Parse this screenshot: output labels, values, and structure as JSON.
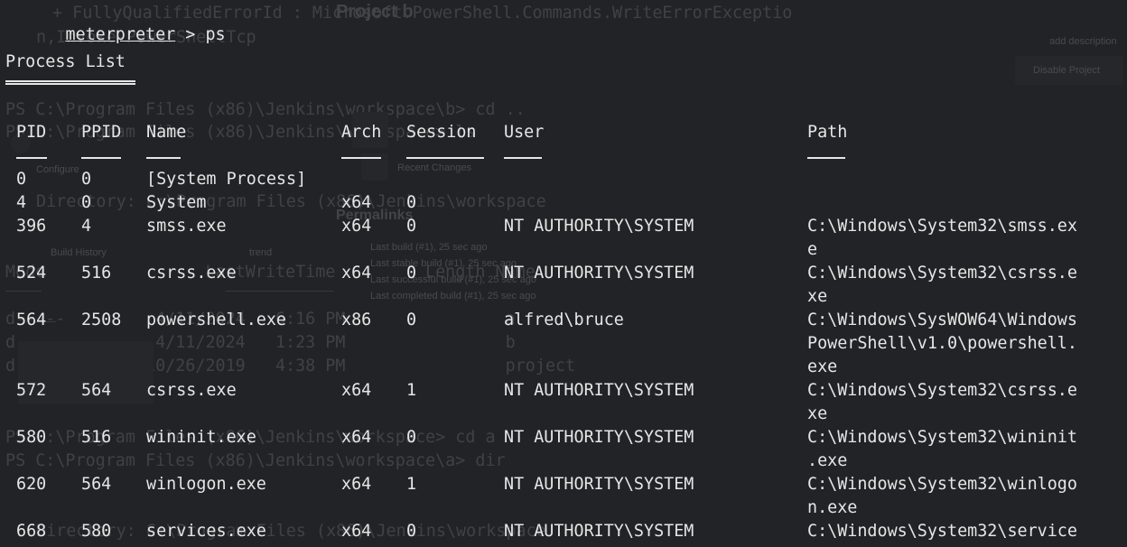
{
  "background_ghost": {
    "line1": "+ FullyQualifiedErrorId : Microsoft.PowerShell.Commands.WriteErrorExceptio",
    "line2": "n,Invoke-PowerShellTcp",
    "line3": "PS C:\\Program Files (x86)\\Jenkins\\workspace\\b> cd ..",
    "line4": "PS C:\\Program Files (x86)\\Jenkins\\workspace> ls",
    "line5": "Directory: C:\\Program Files (x86)\\Jenkins\\workspace",
    "line6": "Mode                LastWriteTime         Length Name",
    "line7": "d-----         4/11/2024   6:16 PM                a",
    "line8": "d-----         4/11/2024   1:23 PM                b",
    "line9": "d-----        10/26/2019   4:38 PM                project",
    "line10": "PS C:\\Program Files (x86)\\Jenkins\\workspace> cd a",
    "line11": "PS C:\\Program Files (x86)\\Jenkins\\workspace\\a> dir",
    "line12": "Directory: C:\\Program Files (x86)\\Jenkins\\workspace",
    "web_title": "Project b",
    "web_recent": "Recent Changes",
    "web_permalinks": "Permalinks",
    "web_build_history": "Build History",
    "web_trend": "trend",
    "web_item1": "Last build (#1), 25 sec ago",
    "web_item2": "Last stable build (#1), 25 sec ago",
    "web_item3": "Last successful build (#1), 25 sec ago",
    "web_item4": "Last completed build (#1), 25 sec ago",
    "web_add_desc": "add description",
    "web_disable": "Disable Project",
    "web_config": "Configure"
  },
  "terminal": {
    "prompt_word": "meterpreter",
    "prompt_rest": " > ps",
    "heading": "Process List",
    "columns": [
      "PID",
      "PPID",
      "Name",
      "Arch",
      "Session",
      "User",
      "Path"
    ],
    "rows": [
      {
        "pid": "0",
        "ppid": "0",
        "name": "[System Process]",
        "arch": "",
        "session": "",
        "user": "",
        "path": ""
      },
      {
        "pid": "4",
        "ppid": "0",
        "name": "System",
        "arch": "x64",
        "session": "0",
        "user": "",
        "path": ""
      },
      {
        "pid": "396",
        "ppid": "4",
        "name": "smss.exe",
        "arch": "x64",
        "session": "0",
        "user": "NT AUTHORITY\\SYSTEM",
        "path": "C:\\Windows\\System32\\smss.ex",
        "path2": "e"
      },
      {
        "pid": "524",
        "ppid": "516",
        "name": "csrss.exe",
        "arch": "x64",
        "session": "0",
        "user": "NT AUTHORITY\\SYSTEM",
        "path": "C:\\Windows\\System32\\csrss.e",
        "path2": "xe"
      },
      {
        "pid": "564",
        "ppid": "2508",
        "name": "powershell.exe",
        "arch": "x86",
        "session": "0",
        "user": "alfred\\bruce",
        "path": "C:\\Windows\\SysWOW64\\Windows",
        "path2": "PowerShell\\v1.0\\powershell.",
        "path3": "exe"
      },
      {
        "pid": "572",
        "ppid": "564",
        "name": "csrss.exe",
        "arch": "x64",
        "session": "1",
        "user": "NT AUTHORITY\\SYSTEM",
        "path": "C:\\Windows\\System32\\csrss.e",
        "path2": "xe"
      },
      {
        "pid": "580",
        "ppid": "516",
        "name": "wininit.exe",
        "arch": "x64",
        "session": "0",
        "user": "NT AUTHORITY\\SYSTEM",
        "path": "C:\\Windows\\System32\\wininit",
        "path2": ".exe"
      },
      {
        "pid": "620",
        "ppid": "564",
        "name": "winlogon.exe",
        "arch": "x64",
        "session": "1",
        "user": "NT AUTHORITY\\SYSTEM",
        "path": "C:\\Windows\\System32\\winlogo",
        "path2": "n.exe"
      },
      {
        "pid": "668",
        "ppid": "580",
        "name": "services.exe",
        "arch": "x64",
        "session": "0",
        "user": "NT AUTHORITY\\SYSTEM",
        "path": "C:\\Windows\\System32\\service"
      }
    ]
  },
  "colors": {
    "background": "#222326",
    "foreground": "#e6e6e6",
    "ghost": "#5a5b60"
  }
}
